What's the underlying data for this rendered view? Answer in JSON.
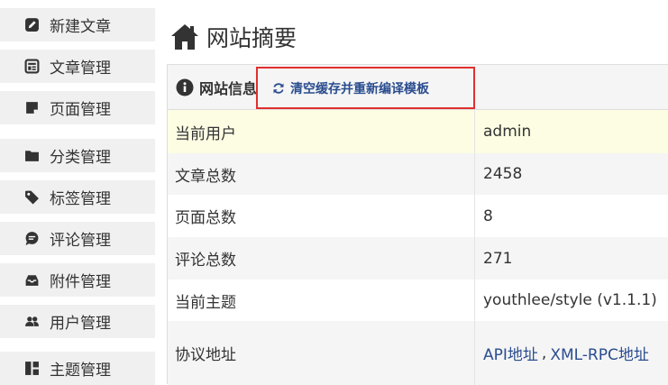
{
  "sidebar": {
    "items": [
      {
        "label": "新建文章",
        "icon": "edit-icon"
      },
      {
        "label": "文章管理",
        "icon": "article-icon"
      },
      {
        "label": "页面管理",
        "icon": "page-icon"
      },
      {
        "label": "分类管理",
        "icon": "folder-icon"
      },
      {
        "label": "标签管理",
        "icon": "tag-icon"
      },
      {
        "label": "评论管理",
        "icon": "comment-icon"
      },
      {
        "label": "附件管理",
        "icon": "inbox-icon"
      },
      {
        "label": "用户管理",
        "icon": "users-icon"
      },
      {
        "label": "主题管理",
        "icon": "dashboard-icon"
      }
    ]
  },
  "main": {
    "title": "网站摘要",
    "title_icon": "home-icon",
    "panel": {
      "title": "网站信息",
      "title_icon": "info-icon",
      "refresh_label": "清空缓存并重新编译模板",
      "refresh_icon": "refresh-icon",
      "rows": [
        {
          "label": "当前用户",
          "value": "admin"
        },
        {
          "label": "文章总数",
          "value": "2458"
        },
        {
          "label": "页面总数",
          "value": "8"
        },
        {
          "label": "评论总数",
          "value": "271"
        },
        {
          "label": "当前主题",
          "value": "youthlee/style (v1.1.1)"
        }
      ],
      "protocol_row": {
        "label": "协议地址",
        "api_link": "API地址",
        "separator": ",",
        "xmlrpc_link": "XML-RPC地址"
      }
    }
  },
  "colors": {
    "link": "#2a4d8f",
    "highlight_border": "#e0302f",
    "row_highlight": "#fdfde3",
    "sidebar_item_bg": "#f0f0f0"
  }
}
